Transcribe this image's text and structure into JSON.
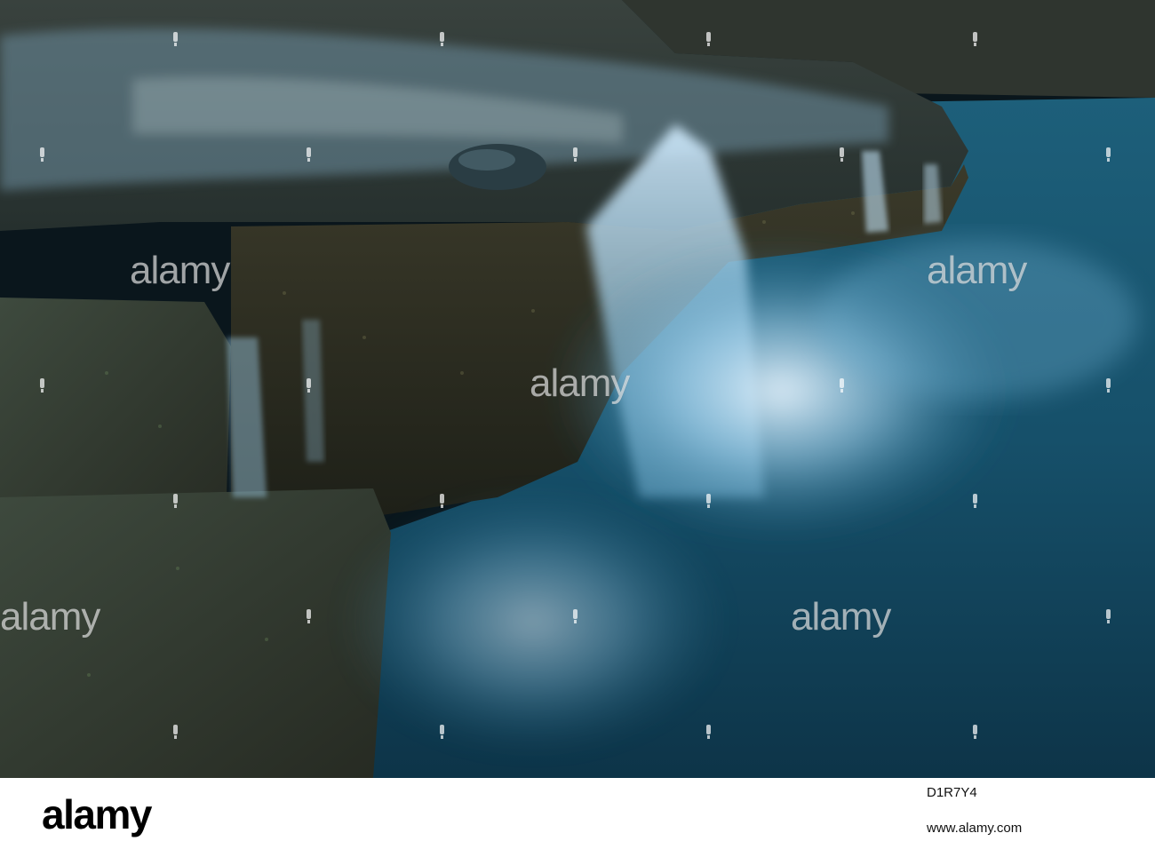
{
  "photo": {
    "subject": "waterfall-over-granite-ledge",
    "colors": {
      "water_highlight": "#e6f4ff",
      "water_deep": "#1d5f7a",
      "rock": "#4a4a34",
      "shadow": "#0a161c"
    }
  },
  "watermark": {
    "text": "alamy"
  },
  "footer": {
    "logo_text": "alamy",
    "image_id": "D1R7Y4",
    "url": "www.alamy.com"
  }
}
